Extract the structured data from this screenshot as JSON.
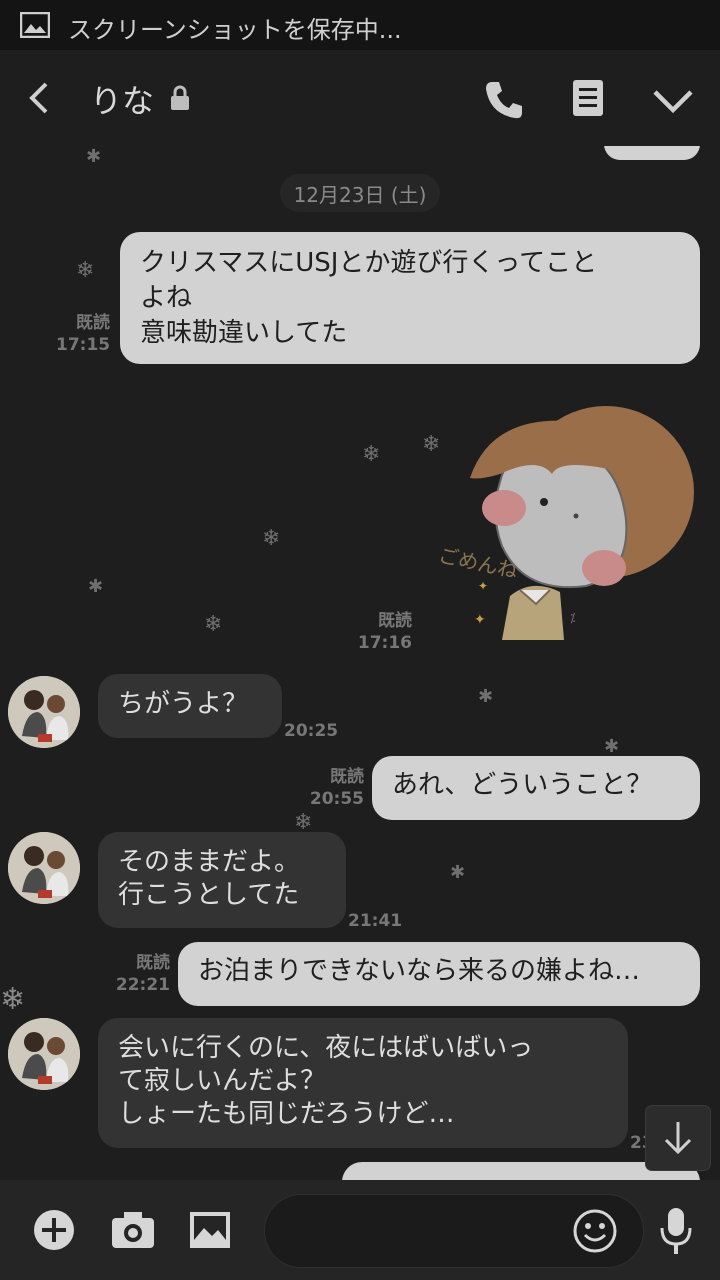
{
  "status_bar": {
    "notification_text": "スクリーンショットを保存中..."
  },
  "header": {
    "contact_name": "りな"
  },
  "chat": {
    "date_label": "12月23日 (土)",
    "messages": [
      {
        "side": "out",
        "text": "クリスマスにUSJとか遊び行くってこと\nよね\n意味勘違いしてた",
        "read": "既読",
        "time": "17:15"
      },
      {
        "side": "out",
        "type": "sticker",
        "sticker_text": "ごめんね",
        "read": "既読",
        "time": "17:16"
      },
      {
        "side": "in",
        "text": "ちがうよ？",
        "time": "20:25"
      },
      {
        "side": "out",
        "text": "あれ、どういうこと？",
        "read": "既読",
        "time": "20:55"
      },
      {
        "side": "in",
        "text": "そのままだよ。\n行こうとしてた",
        "time": "21:41"
      },
      {
        "side": "out",
        "text": "お泊まりできないなら来るの嫌よね…",
        "read": "既読",
        "time": "22:21"
      },
      {
        "side": "in",
        "text": "会いに行くのに、夜にはばいばいっ\nて寂しいんだよ？\nしょーたも同じだろうけど…",
        "time": "23"
      }
    ]
  },
  "colors": {
    "background": "#1e1e1e",
    "outgoing_bubble": "#d2d2d2",
    "incoming_bubble": "#333333",
    "meta_text": "#777777"
  },
  "input_bar": {
    "icons": [
      "plus-icon",
      "camera-icon",
      "image-icon",
      "emoji-icon",
      "microphone-icon"
    ]
  }
}
